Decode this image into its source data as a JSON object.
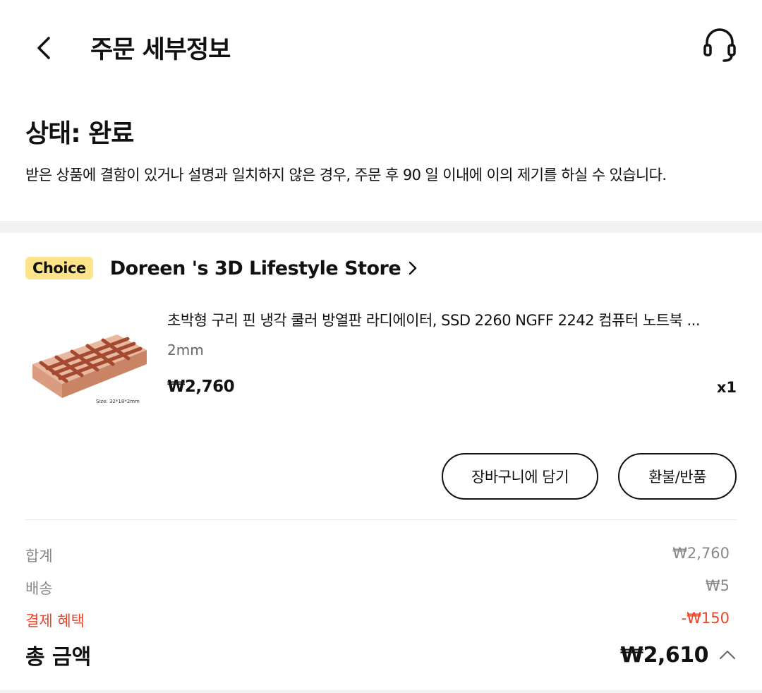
{
  "header": {
    "title": "주문 세부정보"
  },
  "status": {
    "title": "상태: 완료",
    "description": "받은 상품에 결함이 있거나 설명과 일치하지 않은 경우, 주문 후 90 일 이내에 이의 제기를 하실 수 있습니다."
  },
  "store": {
    "badge": "Choice",
    "name": "Doreen 's 3D Lifestyle Store"
  },
  "product": {
    "title": "초박형 구리 핀 냉각 쿨러 방열판 라디에이터, SSD 2260 NGFF 2242 컴퓨터 노트북 ...",
    "variant": "2mm",
    "price": "₩2,760",
    "quantity": "x1",
    "image_caption": "Size: 32*18*2mm"
  },
  "actions": {
    "add_to_cart": "장바구니에 담기",
    "refund": "환불/반품"
  },
  "summary": {
    "subtotal_label": "합계",
    "subtotal_value": "₩2,760",
    "shipping_label": "배송",
    "shipping_value": "₩5",
    "discount_label": "결제 혜택",
    "discount_value": "-₩150",
    "total_label": "총 금액",
    "total_value": "₩2,610"
  },
  "colors": {
    "badge_bg": "#fde48a",
    "discount": "#e8452c",
    "section_gap": "#f2f2f2"
  },
  "icons": {
    "back": "chevron-left-icon",
    "support": "headset-icon",
    "store_link": "chevron-right-icon",
    "total_toggle": "chevron-up-icon"
  }
}
